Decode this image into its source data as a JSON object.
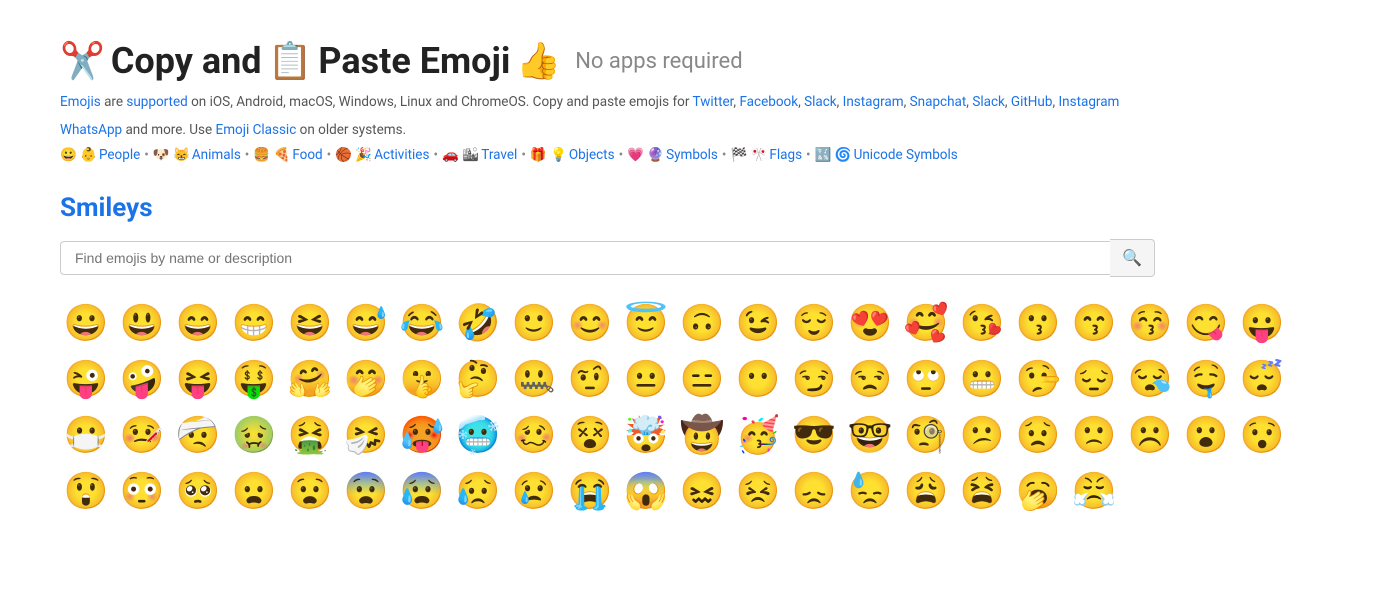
{
  "header": {
    "title_prefix": "✂️ Copy and 📋 Paste Emoji 👍",
    "subtitle": "No apps required",
    "scissors_emoji": "✂️",
    "clipboard_emoji": "📋",
    "thumbsup_emoji": "👍"
  },
  "description": {
    "text1": "Emojis",
    "text2": " are ",
    "text3": "supported",
    "text4": " on iOS, Android, macOS, Windows, Linux and ChromeOS. Copy and paste emojis for ",
    "links1": [
      "Twitter",
      "Facebook",
      "Slack",
      "Instagram",
      "Snapchat",
      "Slack",
      "GitHub",
      "Instagram"
    ],
    "text5": "WhatsApp",
    "text6": " and more. Use ",
    "text7": "Emoji Classic",
    "text8": " on older systems."
  },
  "nav": {
    "items": [
      {
        "label": "😀 👶 People",
        "href": "#people"
      },
      {
        "label": "🐶 😸 Animals",
        "href": "#animals"
      },
      {
        "label": "🍔 🍕 Food",
        "href": "#food"
      },
      {
        "label": "🏀 🎉 Activities",
        "href": "#activities"
      },
      {
        "label": "🚗 🏙 Travel",
        "href": "#travel"
      },
      {
        "label": "🎁 💡 Objects",
        "href": "#objects"
      },
      {
        "label": "💗 🔮 Symbols",
        "href": "#symbols"
      },
      {
        "label": "🏁 🎌 Flags",
        "href": "#flags"
      },
      {
        "label": "🔣 🌀 Unicode Symbols",
        "href": "#unicode"
      }
    ]
  },
  "section": {
    "title": "Smileys"
  },
  "search": {
    "placeholder": "Find emojis by name or description"
  },
  "emojis": {
    "smileys": [
      "😀",
      "😃",
      "😄",
      "😁",
      "😆",
      "😅",
      "😂",
      "🤣",
      "🙂",
      "😊",
      "😇",
      "🙃",
      "😉",
      "😌",
      "😍",
      "🥰",
      "😘",
      "😗",
      "😙",
      "😚",
      "😋",
      "😛",
      "😜",
      "🤪",
      "😝",
      "🤑",
      "🤗",
      "🤭",
      "🤫",
      "🤔",
      "🤐",
      "🤨",
      "😐",
      "😑",
      "😶",
      "😏",
      "😒",
      "🙄",
      "😬",
      "🤥",
      "😔",
      "😪",
      "🤤",
      "😴",
      "😷",
      "🤒",
      "🤕",
      "🤢",
      "🤮",
      "🤧",
      "🥵",
      "🥶",
      "🥴",
      "😵",
      "🤯",
      "🤠",
      "🥳",
      "😎",
      "🤓",
      "🧐",
      "😕",
      "😟",
      "🙁",
      "☹️",
      "😮",
      "😯",
      "😲",
      "😳",
      "🥺",
      "😦",
      "😧",
      "😨",
      "😰",
      "😥",
      "😢",
      "😭",
      "😱",
      "😖",
      "😣",
      "😞",
      "😓",
      "😩",
      "😫",
      "🥱",
      "😤"
    ]
  }
}
